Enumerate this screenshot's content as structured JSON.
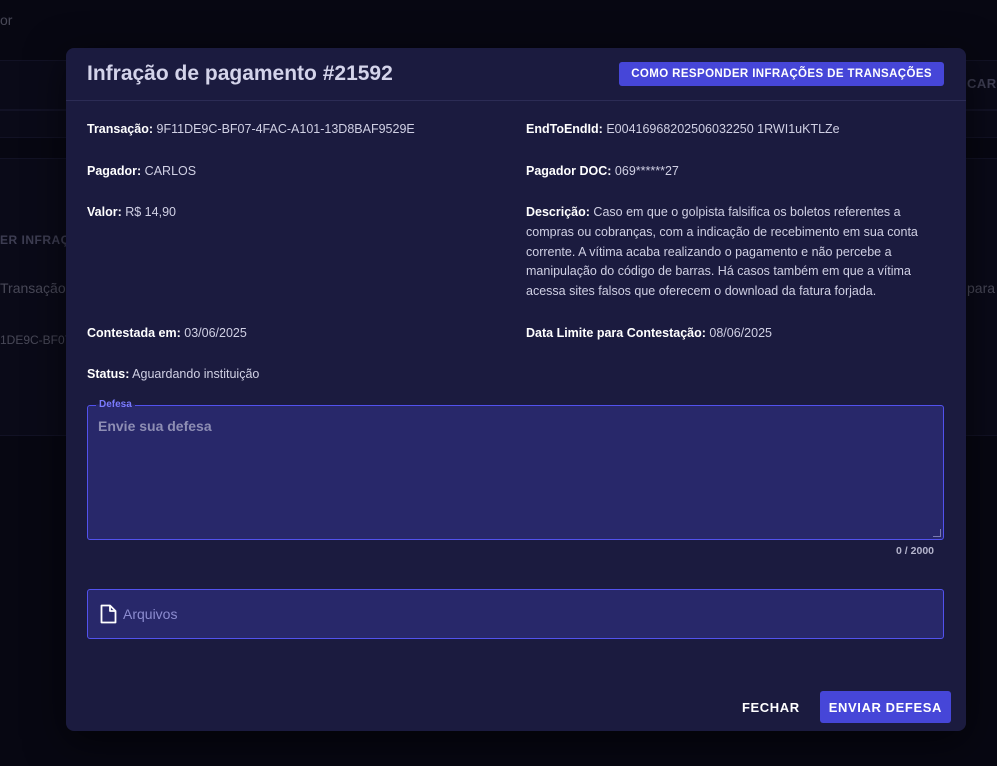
{
  "background": {
    "top_fragment": "or",
    "right_button_fragment": "CAR",
    "tab_fragment": "ER INFRAÇÃO",
    "column_fragment": "Transação",
    "right_column_fragment": "para",
    "row_fragment": "1DE9C-BF07"
  },
  "modal": {
    "title": "Infração de pagamento #21592",
    "help_button": "COMO RESPONDER INFRAÇÕES DE TRANSAÇÕES",
    "fields": {
      "transacao_label": "Transação:",
      "transacao_value": "9F11DE9C-BF07-4FAC-A101-13D8BAF9529E",
      "endtoend_label": "EndToEndId:",
      "endtoend_value": "E00416968202506032250 1RWI1uKTLZe",
      "pagador_label": "Pagador:",
      "pagador_value": "CARLOS",
      "pagador_doc_label": "Pagador DOC:",
      "pagador_doc_value": "069******27",
      "valor_label": "Valor:",
      "valor_value": "R$ 14,90",
      "descricao_label": "Descrição:",
      "descricao_value": "Caso em que o golpista falsifica os boletos referentes a compras ou cobranças, com a indicação de recebimento em sua conta corrente. A vítima acaba realizando o pagamento e não percebe a manipulação do código de barras. Há casos também em que a vítima acessa sites falsos que oferecem o download da fatura forjada.",
      "contestada_label": "Contestada em:",
      "contestada_value": "03/06/2025",
      "data_limite_label": "Data Limite para Contestação:",
      "data_limite_value": "08/06/2025",
      "status_label": "Status:",
      "status_value": "Aguardando instituição"
    },
    "defesa": {
      "legend": "Defesa",
      "placeholder": "Envie sua defesa",
      "value": "",
      "counter": "0 / 2000"
    },
    "files": {
      "icon": "file-icon",
      "label": "Arquivos"
    },
    "actions": {
      "close_label": "FECHAR",
      "submit_label": "ENVIAR DEFESA"
    }
  },
  "colors": {
    "accent": "#4646d8",
    "modal_bg": "#1b1b3f",
    "input_bg": "#28286a",
    "input_border": "#5252ee"
  }
}
